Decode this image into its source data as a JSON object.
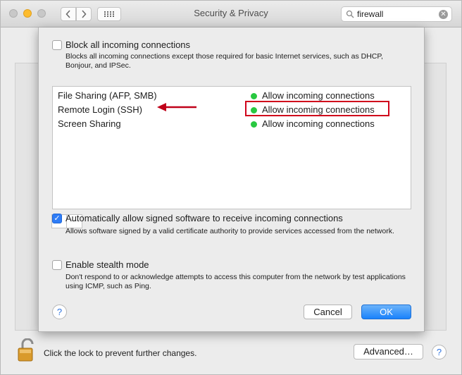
{
  "window": {
    "title": "Security & Privacy"
  },
  "search": {
    "value": "firewall",
    "icon": "search-icon",
    "clear_icon": "clear-icon"
  },
  "sheet": {
    "block_all": {
      "label": "Block all incoming connections",
      "checked": false,
      "description": "Blocks all incoming connections except those required for basic Internet services,  such as DHCP, Bonjour, and IPSec."
    },
    "services": [
      {
        "name": "File Sharing (AFP, SMB)",
        "status": "Allow incoming connections",
        "status_color": "#28c840"
      },
      {
        "name": "Remote Login (SSH)",
        "status": "Allow incoming connections",
        "status_color": "#28c840"
      },
      {
        "name": "Screen Sharing",
        "status": "Allow incoming connections",
        "status_color": "#28c840"
      }
    ],
    "add_symbol": "+",
    "remove_symbol": "−",
    "auto_allow": {
      "label": "Automatically allow signed software to receive incoming connections",
      "checked": true,
      "description": "Allows software signed by a valid certificate authority to provide services accessed from the network."
    },
    "stealth": {
      "label": "Enable stealth mode",
      "checked": false,
      "description": "Don't respond to or acknowledge attempts to access this computer from the network by test applications using ICMP, such as Ping."
    },
    "help_symbol": "?",
    "cancel_label": "Cancel",
    "ok_label": "OK"
  },
  "footer": {
    "lock_text": "Click the lock to prevent further changes.",
    "advanced_label": "Advanced…",
    "help_symbol": "?"
  },
  "colors": {
    "accent": "#2e7cf6",
    "annotation": "#d0021b",
    "status_green": "#28c840"
  }
}
